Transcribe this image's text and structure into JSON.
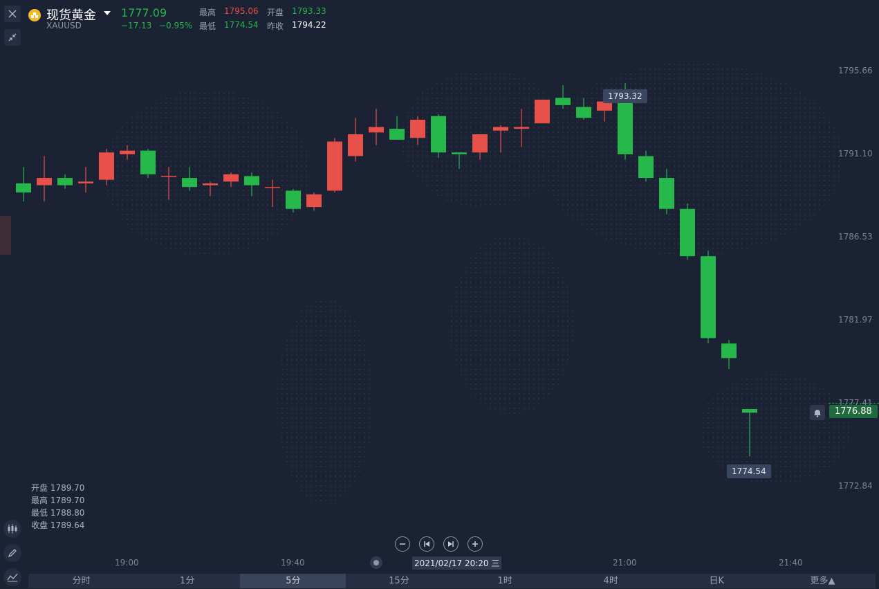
{
  "header": {
    "title": "现货黄金",
    "symbol": "XAUUSD",
    "last_price": "1777.09",
    "change": "−17.13",
    "change_pct": "−0.95%",
    "high_label": "最高",
    "high_value": "1795.06",
    "open_label": "开盘",
    "open_value": "1793.33",
    "low_label": "最低",
    "low_value": "1774.54",
    "prev_close_label": "昨收",
    "prev_close_value": "1794.22"
  },
  "ohlc_info": {
    "open": "开盘 1789.70",
    "high": "最高 1789.70",
    "low": "最低 1788.80",
    "close": "收盘 1789.64"
  },
  "chart_data": {
    "type": "candlestick",
    "y_ticks": [
      "1795.66",
      "1791.10",
      "1786.53",
      "1781.97",
      "1777.41",
      "1772.84"
    ],
    "x_ticks": [
      "19:00",
      "19:40",
      "21:00",
      "21:40"
    ],
    "interval": "5分",
    "max_tip": "1793.32",
    "min_tip": "1774.54",
    "current_price": "1776.88",
    "up_color": "#e8504a",
    "down_color": "#26b84b",
    "candles": [
      {
        "o": 1789.5,
        "h": 1790.4,
        "l": 1788.5,
        "c": 1789.0
      },
      {
        "o": 1789.4,
        "h": 1791.0,
        "l": 1788.5,
        "c": 1789.8
      },
      {
        "o": 1789.8,
        "h": 1790.0,
        "l": 1789.2,
        "c": 1789.4
      },
      {
        "o": 1789.5,
        "h": 1790.4,
        "l": 1789.0,
        "c": 1789.6
      },
      {
        "o": 1789.7,
        "h": 1791.4,
        "l": 1789.4,
        "c": 1791.2
      },
      {
        "o": 1791.1,
        "h": 1791.6,
        "l": 1790.8,
        "c": 1791.3
      },
      {
        "o": 1791.3,
        "h": 1791.4,
        "l": 1789.8,
        "c": 1790.0
      },
      {
        "o": 1789.9,
        "h": 1790.4,
        "l": 1788.6,
        "c": 1789.9
      },
      {
        "o": 1789.8,
        "h": 1790.4,
        "l": 1789.1,
        "c": 1789.3
      },
      {
        "o": 1789.4,
        "h": 1789.6,
        "l": 1788.8,
        "c": 1789.5
      },
      {
        "o": 1789.6,
        "h": 1790.1,
        "l": 1789.3,
        "c": 1790.0
      },
      {
        "o": 1789.9,
        "h": 1790.1,
        "l": 1788.8,
        "c": 1789.4
      },
      {
        "o": 1789.3,
        "h": 1789.7,
        "l": 1788.2,
        "c": 1789.3
      },
      {
        "o": 1789.1,
        "h": 1789.2,
        "l": 1787.9,
        "c": 1788.1
      },
      {
        "o": 1788.2,
        "h": 1789.0,
        "l": 1788.0,
        "c": 1788.9
      },
      {
        "o": 1789.1,
        "h": 1792.0,
        "l": 1789.0,
        "c": 1791.8
      },
      {
        "o": 1791.0,
        "h": 1793.1,
        "l": 1790.7,
        "c": 1792.2
      },
      {
        "o": 1792.3,
        "h": 1793.6,
        "l": 1791.6,
        "c": 1792.6
      },
      {
        "o": 1792.5,
        "h": 1793.2,
        "l": 1791.9,
        "c": 1791.9
      },
      {
        "o": 1792.0,
        "h": 1793.2,
        "l": 1791.6,
        "c": 1793.0
      },
      {
        "o": 1793.2,
        "h": 1793.3,
        "l": 1790.9,
        "c": 1791.2
      },
      {
        "o": 1791.2,
        "h": 1791.2,
        "l": 1790.3,
        "c": 1791.1
      },
      {
        "o": 1791.2,
        "h": 1792.2,
        "l": 1790.8,
        "c": 1792.2
      },
      {
        "o": 1792.4,
        "h": 1792.7,
        "l": 1791.2,
        "c": 1792.6
      },
      {
        "o": 1792.5,
        "h": 1793.6,
        "l": 1791.5,
        "c": 1792.6
      },
      {
        "o": 1792.8,
        "h": 1794.1,
        "l": 1792.8,
        "c": 1794.1
      },
      {
        "o": 1794.2,
        "h": 1794.9,
        "l": 1793.6,
        "c": 1793.8
      },
      {
        "o": 1793.7,
        "h": 1794.2,
        "l": 1793.0,
        "c": 1793.1
      },
      {
        "o": 1793.5,
        "h": 1794.5,
        "l": 1792.9,
        "c": 1794.0
      },
      {
        "o": 1794.2,
        "h": 1795.0,
        "l": 1790.8,
        "c": 1791.1
      },
      {
        "o": 1791.0,
        "h": 1791.3,
        "l": 1789.6,
        "c": 1789.8
      },
      {
        "o": 1789.8,
        "h": 1790.3,
        "l": 1787.8,
        "c": 1788.1
      },
      {
        "o": 1788.1,
        "h": 1788.4,
        "l": 1785.3,
        "c": 1785.5
      },
      {
        "o": 1785.5,
        "h": 1785.8,
        "l": 1780.7,
        "c": 1781.0
      },
      {
        "o": 1780.7,
        "h": 1780.9,
        "l": 1779.3,
        "c": 1779.9
      },
      {
        "o": 1777.1,
        "h": 1777.1,
        "l": 1774.5,
        "c": 1776.9
      }
    ]
  },
  "bottom_tabs": [
    "分时",
    "1分",
    "5分",
    "15分",
    "1时",
    "4时",
    "日K",
    "更多▲"
  ],
  "active_tab": 2,
  "date_tag": "2021/02/17 20:20 三"
}
